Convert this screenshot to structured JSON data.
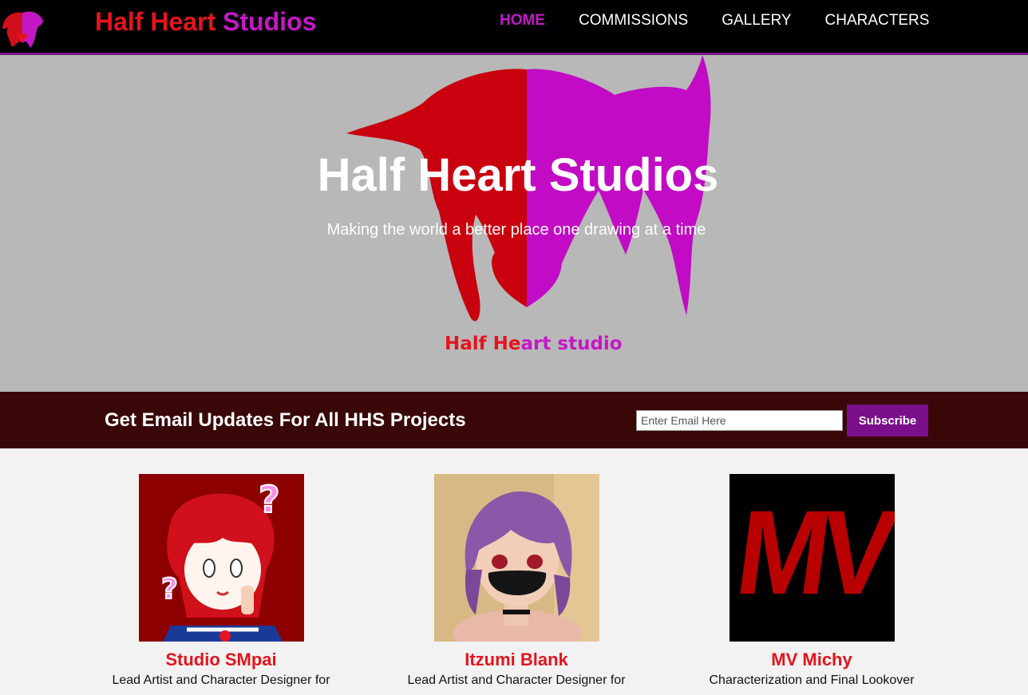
{
  "nav": {
    "brand_part1": "Half Heart",
    "brand_part2": "Studios",
    "links": [
      {
        "label": "HOME",
        "active": true
      },
      {
        "label": "COMMISSIONS",
        "active": false
      },
      {
        "label": "GALLERY",
        "active": false
      },
      {
        "label": "CHARACTERS",
        "active": false
      }
    ]
  },
  "hero": {
    "title": "Half Heart Studios",
    "subtitle": "Making the world a better place one drawing at a time",
    "logo_caption_part1": "Half He",
    "logo_caption_part2": "art studio"
  },
  "email": {
    "heading": "Get Email Updates For All HHS Projects",
    "placeholder": "Enter Email Here",
    "button_label": "Subscribe"
  },
  "team": [
    {
      "name": "Studio SMpai",
      "role": "Lead Artist and Character Designer for"
    },
    {
      "name": "Itzumi Blank",
      "role": "Lead Artist and Character Designer for"
    },
    {
      "name": "MV Michy",
      "role": "Characterization and Final Lookover",
      "logo_text": "MV"
    }
  ],
  "colors": {
    "brand_red": "#e5141c",
    "brand_magenta": "#c418c6",
    "nav_bg": "#000000",
    "hero_bg": "#b8b8b8",
    "email_bar_bg": "#3a0709",
    "button_purple": "#7a0f8a"
  }
}
